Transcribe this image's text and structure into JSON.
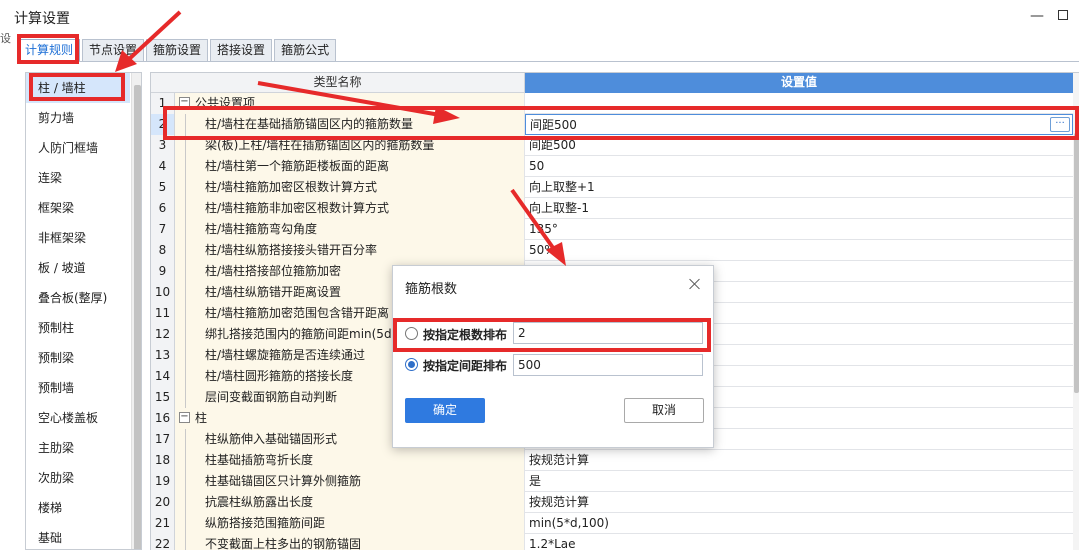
{
  "window": {
    "title": "计算设置",
    "minimize_glyph": "—",
    "edge_mark": "设"
  },
  "tabs": [
    {
      "label": "计算规则"
    },
    {
      "label": "节点设置"
    },
    {
      "label": "箍筋设置"
    },
    {
      "label": "搭接设置"
    },
    {
      "label": "箍筋公式"
    }
  ],
  "categories": [
    "柱 / 墙柱",
    "剪力墙",
    "人防门框墙",
    "连梁",
    "框架梁",
    "非框架梁",
    "板 / 坡道",
    "叠合板(整厚)",
    "预制柱",
    "预制梁",
    "预制墙",
    "空心楼盖板",
    "主肋梁",
    "次肋梁",
    "楼梯",
    "基础"
  ],
  "grid": {
    "header_name": "类型名称",
    "header_value": "设置值",
    "rows": [
      {
        "num": "1",
        "name": "公共设置项",
        "value": ""
      },
      {
        "num": "2",
        "name": "柱/墙柱在基础插筋锚固区内的箍筋数量",
        "value": "间距500"
      },
      {
        "num": "3",
        "name": "梁(板)上柱/墙柱在插筋锚固区内的箍筋数量",
        "value": "间距500"
      },
      {
        "num": "4",
        "name": "柱/墙柱第一个箍筋距楼板面的距离",
        "value": "50"
      },
      {
        "num": "5",
        "name": "柱/墙柱箍筋加密区根数计算方式",
        "value": "向上取整+1"
      },
      {
        "num": "6",
        "name": "柱/墙柱箍筋非加密区根数计算方式",
        "value": "向上取整-1"
      },
      {
        "num": "7",
        "name": "柱/墙柱箍筋弯勾角度",
        "value": "135°"
      },
      {
        "num": "8",
        "name": "柱/墙柱纵筋搭接接头错开百分率",
        "value": "50%"
      },
      {
        "num": "9",
        "name": "柱/墙柱搭接部位箍筋加密",
        "value": ""
      },
      {
        "num": "10",
        "name": "柱/墙柱纵筋错开距离设置",
        "value": ""
      },
      {
        "num": "11",
        "name": "柱/墙柱箍筋加密范围包含错开距离",
        "value": ""
      },
      {
        "num": "12",
        "name": "绑扎搭接范围内的箍筋间距min(5d,100)",
        "value": ""
      },
      {
        "num": "13",
        "name": "柱/墙柱螺旋箍筋是否连续通过",
        "value": ""
      },
      {
        "num": "14",
        "name": "柱/墙柱圆形箍筋的搭接长度",
        "value": ""
      },
      {
        "num": "15",
        "name": "层间变截面钢筋自动判断",
        "value": ""
      },
      {
        "num": "16",
        "name": "柱",
        "value": ""
      },
      {
        "num": "17",
        "name": "柱纵筋伸入基础锚固形式",
        "value": ""
      },
      {
        "num": "18",
        "name": "柱基础插筋弯折长度",
        "value": "按规范计算"
      },
      {
        "num": "19",
        "name": "柱基础锚固区只计算外侧箍筋",
        "value": "是"
      },
      {
        "num": "20",
        "name": "抗震柱纵筋露出长度",
        "value": "按规范计算"
      },
      {
        "num": "21",
        "name": "纵筋搭接范围箍筋间距",
        "value": "min(5*d,100)"
      },
      {
        "num": "22",
        "name": "不变截面上柱多出的钢筋锚固",
        "value": "1.2*Lae"
      }
    ],
    "ellipsis_glyph": "···",
    "toggle_glyph": "−"
  },
  "dialog": {
    "title": "箍筋根数",
    "option_count_label": "按指定根数排布",
    "option_count_value": "2",
    "option_spacing_label": "按指定间距排布",
    "option_spacing_value": "500",
    "selected_option": "spacing",
    "ok_label": "确定",
    "cancel_label": "取消"
  },
  "colors": {
    "accent": "#4e8ddb",
    "annotation_red": "#e62a2a",
    "selected_bg": "#d5e6fb",
    "name_cell_bg": "#fdf8e9"
  },
  "icons": [
    "minimize-icon",
    "maximize-icon",
    "close-icon",
    "collapse-toggle-icon",
    "ellipsis-icon",
    "radio-icon"
  ]
}
